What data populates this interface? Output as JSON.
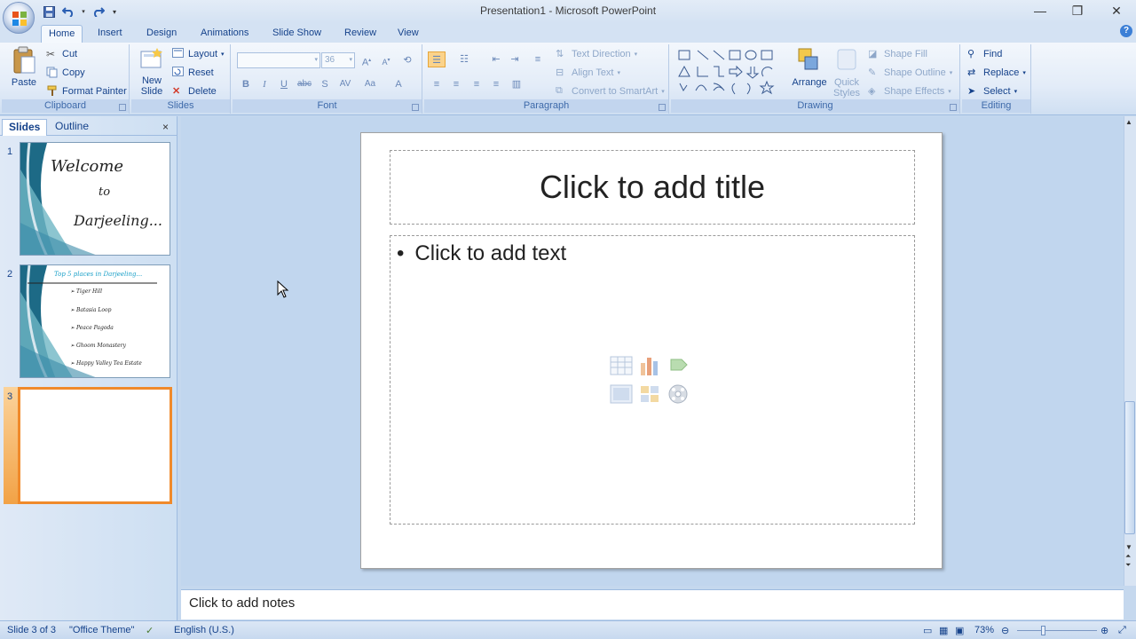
{
  "window": {
    "title": "Presentation1 - Microsoft PowerPoint",
    "controls": [
      "minimize-icon",
      "restore-icon",
      "close-icon"
    ]
  },
  "tabs": [
    "Home",
    "Insert",
    "Design",
    "Animations",
    "Slide Show",
    "Review",
    "View"
  ],
  "active_tab": "Home",
  "ribbon": {
    "clipboard": {
      "label": "Clipboard",
      "paste": "Paste",
      "cut": "Cut",
      "copy": "Copy",
      "format_painter": "Format Painter"
    },
    "slides": {
      "label": "Slides",
      "new_slide_1": "New",
      "new_slide_2": "Slide",
      "layout": "Layout",
      "reset": "Reset",
      "delete": "Delete"
    },
    "font": {
      "label": "Font",
      "font_name": "",
      "font_size": "36"
    },
    "paragraph": {
      "label": "Paragraph",
      "text_direction": "Text Direction",
      "align_text": "Align Text",
      "convert_smartart": "Convert to SmartArt"
    },
    "drawing": {
      "label": "Drawing",
      "arrange": "Arrange",
      "quick_styles_1": "Quick",
      "quick_styles_2": "Styles",
      "shape_fill": "Shape Fill",
      "shape_outline": "Shape Outline",
      "shape_effects": "Shape Effects"
    },
    "editing": {
      "label": "Editing",
      "find": "Find",
      "replace": "Replace",
      "select": "Select"
    }
  },
  "pane": {
    "tabs": [
      "Slides",
      "Outline"
    ],
    "close": "×",
    "slides": [
      {
        "num": "1",
        "text_1": "Welcome",
        "text_2": "to",
        "text_3": "Darjeeling..."
      },
      {
        "num": "2",
        "heading": "Top 5 places in Darjeeling...",
        "items": [
          "Tiger Hill",
          "Batasia Loop",
          "Peace Pagoda",
          "Ghoom Monastery",
          "Happy Valley Tea Estate"
        ]
      },
      {
        "num": "3"
      }
    ]
  },
  "slide": {
    "title_placeholder": "Click to add title",
    "text_placeholder": "Click to add text",
    "bullet": "•"
  },
  "notes": {
    "placeholder": "Click to add notes"
  },
  "status": {
    "slide_info": "Slide 3 of 3",
    "theme": "\"Office Theme\"",
    "language": "English (U.S.)",
    "zoom": "73%"
  },
  "colors": {
    "accent": "#15428b",
    "selected_slide": "#f08a2b"
  }
}
